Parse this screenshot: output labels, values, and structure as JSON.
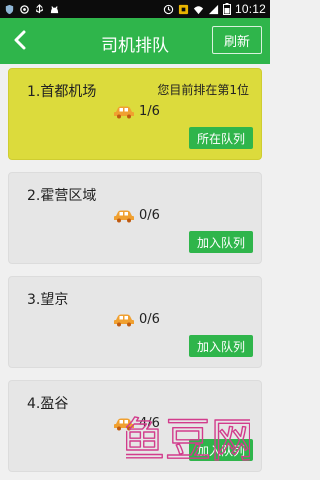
{
  "status_bar": {
    "time": "10:12",
    "icons": [
      "shield-icon",
      "location-icon",
      "usb-icon",
      "cat-icon",
      "clock-icon",
      "android-icon",
      "wifi-icon",
      "signal-icon",
      "battery-icon"
    ]
  },
  "header": {
    "title": "司机排队",
    "refresh_label": "刷新",
    "color": "#2fb54b"
  },
  "queues": [
    {
      "name": "1.首都机场",
      "note": "您目前排在第1位",
      "count": "1/6",
      "button": "所在队列",
      "active": true
    },
    {
      "name": "2.霍营区域",
      "note": "",
      "count": "0/6",
      "button": "加入队列",
      "active": false
    },
    {
      "name": "3.望京",
      "note": "",
      "count": "0/6",
      "button": "加入队列",
      "active": false
    },
    {
      "name": "4.盈谷",
      "note": "",
      "count": "4/6",
      "button": "加入队列",
      "active": false
    }
  ],
  "colors": {
    "active_card": "#dcdb3c",
    "card": "#e6e6e6",
    "button": "#2fb54b",
    "car": "#f0a030"
  },
  "watermark": {
    "text": "鱼豆网"
  }
}
